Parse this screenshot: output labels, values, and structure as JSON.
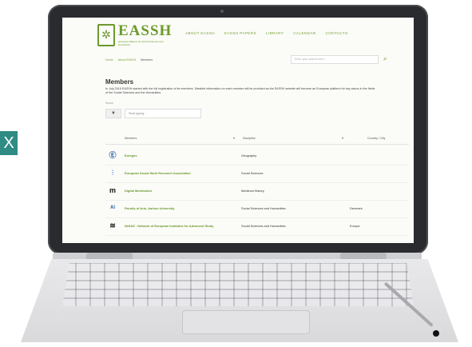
{
  "badge": {
    "text": "X"
  },
  "site": {
    "logo_title": "EASSH",
    "logo_sub": "European Alliance for Social Sciences and Humanities",
    "nav": [
      "ABOUT EASSH",
      "EASSH PAPERS",
      "LIBRARY",
      "CALENDAR",
      "CONTACTS"
    ]
  },
  "breadcrumb": [
    "Home",
    "About EASSH",
    "Members"
  ],
  "search": {
    "placeholder": "Enter your search term..."
  },
  "page": {
    "title": "Members",
    "intro": "In July 2015 EASSH started with the full registration of its members. Detailed information on each member will be provided as the EASSH website will become an European platform for key actors in the fields of the Social Sciences and the Humanities."
  },
  "filter": {
    "label": "Search",
    "placeholder": "Start typing..."
  },
  "table": {
    "headers": [
      "Members",
      "Discipline",
      "Country / City"
    ],
    "rows": [
      {
        "logo": "Ⓔ",
        "logo_color": "#2a5aa8",
        "name": "Euregeo",
        "discipline": "Geography",
        "country": ""
      },
      {
        "logo": "⫶",
        "logo_color": "#2a86c9",
        "name": "European Social Work Research Association",
        "discipline": "Social Sciences",
        "country": ""
      },
      {
        "logo": "m",
        "logo_color": "#111111",
        "name": "Digital Medievalist",
        "discipline": "Medieval History",
        "country": ""
      },
      {
        "logo": "ᴬᴵ",
        "logo_color": "#3a6fb0",
        "name": "Faculty of Arts, Aarhus University",
        "discipline": "Social Sciences and Humanities",
        "country": "Denmark"
      },
      {
        "logo": "≋",
        "logo_color": "#222222",
        "name": "NetIAS - Network of European Institutes for Advanced Study",
        "discipline": "Social Sciences and Humanities",
        "country": "Europe"
      }
    ]
  },
  "colors": {
    "accent": "#6b9a2a",
    "badge": "#2f8b83"
  }
}
